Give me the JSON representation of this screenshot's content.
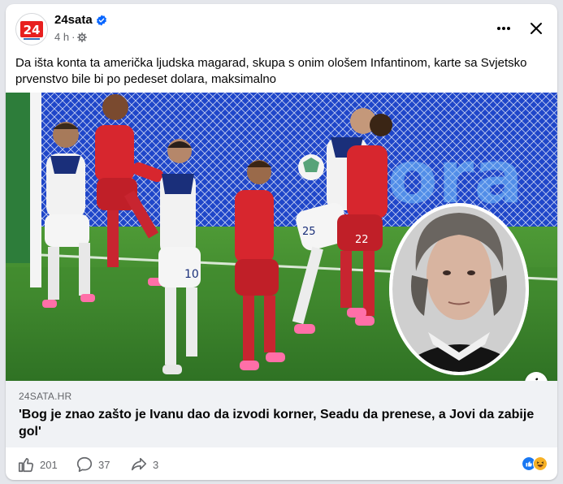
{
  "post": {
    "page_name": "24sata",
    "logo_text": "24",
    "time": "4 h",
    "separator": "·",
    "text": "Da išta konta ta američka ljudska magarad, skupa s onim ološem Infantinom, karte sa Svjetsko prvenstvo bile bi po pedeset dolara, maksimalno",
    "image_info_icon": "i"
  },
  "link_preview": {
    "domain": "24SATA.HR",
    "title": "'Bog je znao zašto je Ivanu dao da izvodi korner, Seadu da prenese, a Jovi da zabije gol'"
  },
  "actions": {
    "like_count": "201",
    "comment_count": "37",
    "share_count": "3",
    "reaction_icons": [
      "like-icon",
      "haha-icon"
    ]
  },
  "icons": {
    "verified": "verified-badge-icon",
    "privacy": "globe-icon",
    "more": "more-dots-icon",
    "close": "close-icon",
    "like": "thumbs-up-icon",
    "comment": "comment-bubble-icon",
    "share": "share-arrow-icon"
  },
  "colors": {
    "logo_red": "#e8201f",
    "verified_blue": "#0866ff",
    "link_bg": "#f0f2f5",
    "meta_gray": "#65676b",
    "croatia_red": "#d7262e",
    "pitch_green": "#3f8a2e"
  }
}
